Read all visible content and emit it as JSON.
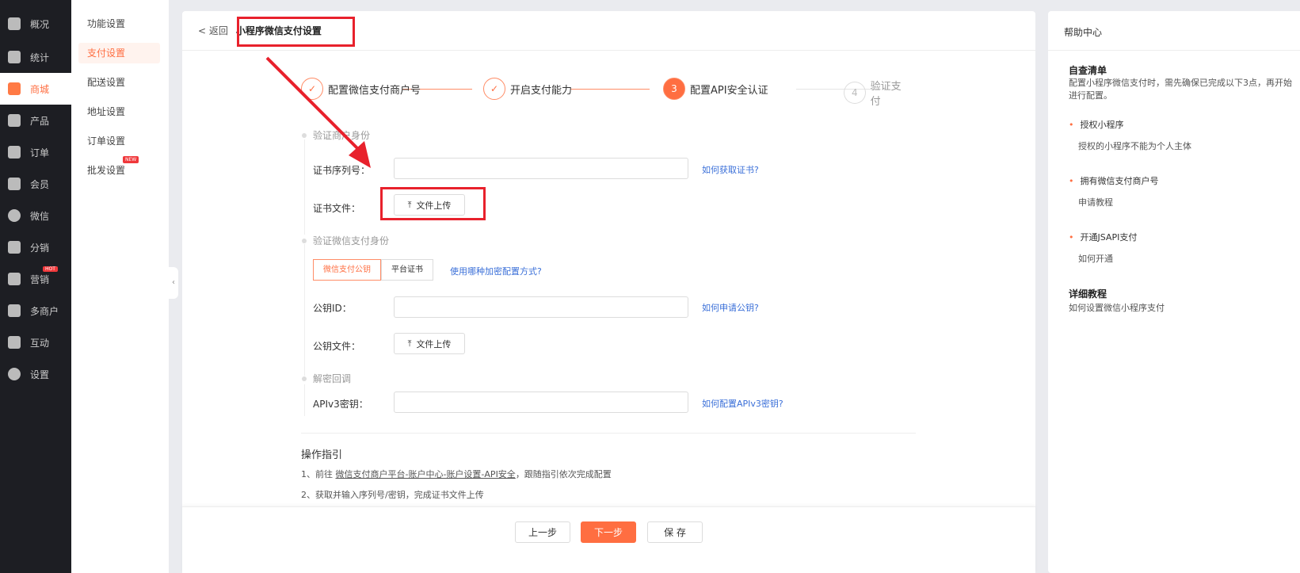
{
  "nav": {
    "items": [
      {
        "label": "概况",
        "icon": "layers-icon"
      },
      {
        "label": "统计",
        "icon": "chart-icon"
      },
      {
        "label": "商城",
        "icon": "shop-icon",
        "active": true
      },
      {
        "label": "产品",
        "icon": "grid-icon"
      },
      {
        "label": "订单",
        "icon": "clipboard-icon"
      },
      {
        "label": "会员",
        "icon": "crown-icon"
      },
      {
        "label": "微信",
        "icon": "wechat-icon"
      },
      {
        "label": "分销",
        "icon": "users-icon"
      },
      {
        "label": "营销",
        "icon": "flag-icon",
        "badge": "HOT"
      },
      {
        "label": "多商户",
        "icon": "store-plus-icon"
      },
      {
        "label": "互动",
        "icon": "interact-icon"
      },
      {
        "label": "设置",
        "icon": "gear-icon"
      }
    ]
  },
  "subnav": {
    "items": [
      {
        "label": "功能设置"
      },
      {
        "label": "支付设置",
        "active": true
      },
      {
        "label": "配送设置"
      },
      {
        "label": "地址设置"
      },
      {
        "label": "订单设置"
      },
      {
        "label": "批发设置",
        "badge": "NEW"
      }
    ]
  },
  "header": {
    "back": "< 返回",
    "title": "小程序微信支付设置"
  },
  "steps": [
    {
      "num": "✓",
      "label": "配置微信支付商户号"
    },
    {
      "num": "✓",
      "label": "开启支付能力"
    },
    {
      "num": "3",
      "label": "配置API安全认证"
    },
    {
      "num": "4",
      "label": "验证支付"
    }
  ],
  "form": {
    "section1": "验证商户身份",
    "cert_serial_label": "证书序列号：",
    "cert_serial_value": "",
    "cert_serial_link": "如何获取证书?",
    "cert_file_label": "证书文件：",
    "upload_label": "文件上传",
    "section2": "验证微信支付身份",
    "tabs": [
      "微信支付公钥",
      "平台证书"
    ],
    "tabs_link": "使用哪种加密配置方式?",
    "pubkey_id_label": "公钥ID：",
    "pubkey_id_value": "",
    "pubkey_id_link": "如何申请公钥?",
    "pubkey_file_label": "公钥文件：",
    "section3": "解密回调",
    "apiv3_label": "APIv3密钥：",
    "apiv3_value": "",
    "apiv3_link": "如何配置APIv3密钥?"
  },
  "guide": {
    "title": "操作指引",
    "line1_prefix": "1、前往 ",
    "line1_link": "微信支付商户平台-账户中心-账户设置-API安全",
    "line1_suffix": "，跟随指引依次完成配置",
    "line2": "2、获取并输入序列号/密钥，完成证书文件上传"
  },
  "footer": {
    "prev": "上一步",
    "next": "下一步",
    "save": "保 存"
  },
  "help": {
    "title": "帮助中心",
    "checklist_title": "自查清单",
    "checklist_desc": "配置小程序微信支付时，需先确保已完成以下3点，再开始进行配置。",
    "items": [
      {
        "title": "授权小程序",
        "sub": "授权的小程序不能为个人主体"
      },
      {
        "title": "拥有微信支付商户号",
        "sub": "申请教程"
      },
      {
        "title": "开通JSAPI支付",
        "sub": "如何开通"
      }
    ],
    "tutorial_title": "详细教程",
    "tutorial_link": "如何设置微信小程序支付"
  },
  "colors": {
    "accent": "#ff6e41",
    "annotation": "#e8212c",
    "link": "#3a6fd8"
  }
}
